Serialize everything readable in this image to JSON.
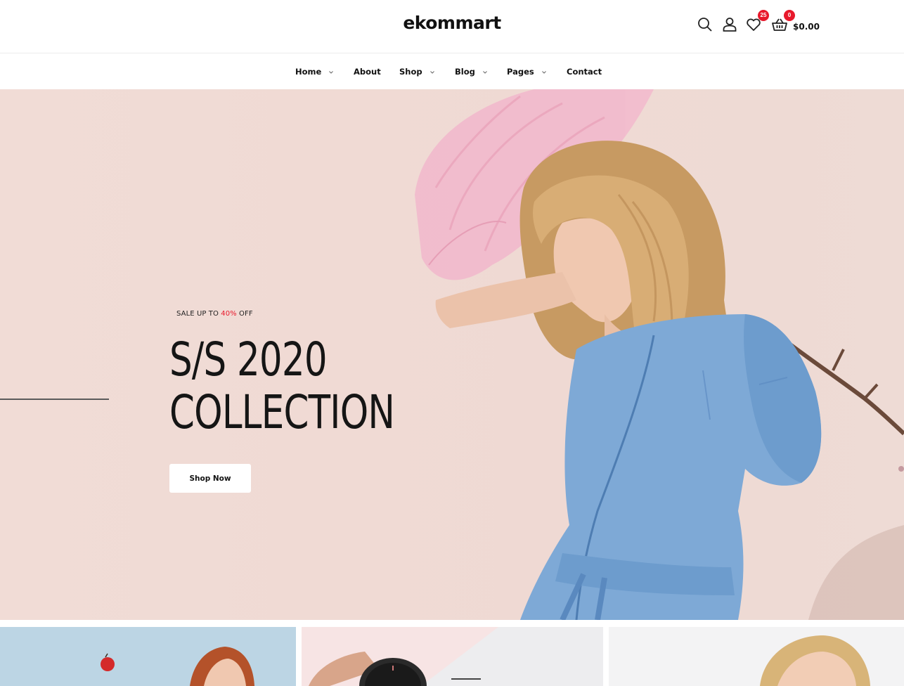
{
  "header": {
    "logo": "ekommart",
    "wishlist_count": "25",
    "cart_count": "0",
    "cart_total": "$0.00",
    "icons": [
      "search-icon",
      "user-icon",
      "heart-icon",
      "basket-icon"
    ]
  },
  "nav": {
    "items": [
      {
        "label": "Home",
        "dropdown": true
      },
      {
        "label": "About",
        "dropdown": false
      },
      {
        "label": "Shop",
        "dropdown": true
      },
      {
        "label": "Blog",
        "dropdown": true
      },
      {
        "label": "Pages",
        "dropdown": true
      },
      {
        "label": "Contact",
        "dropdown": false
      }
    ]
  },
  "hero": {
    "sale_prefix": "SALE UP TO ",
    "sale_percent": "40%",
    "sale_suffix": " OFF",
    "title_line1": "S/S 2020",
    "title_line2": "COLLECTION",
    "button_label": "Shop Now"
  },
  "colors": {
    "accent": "#e8192c",
    "hero_background": "#f0dbd5",
    "denim": "#7ea9d6"
  }
}
